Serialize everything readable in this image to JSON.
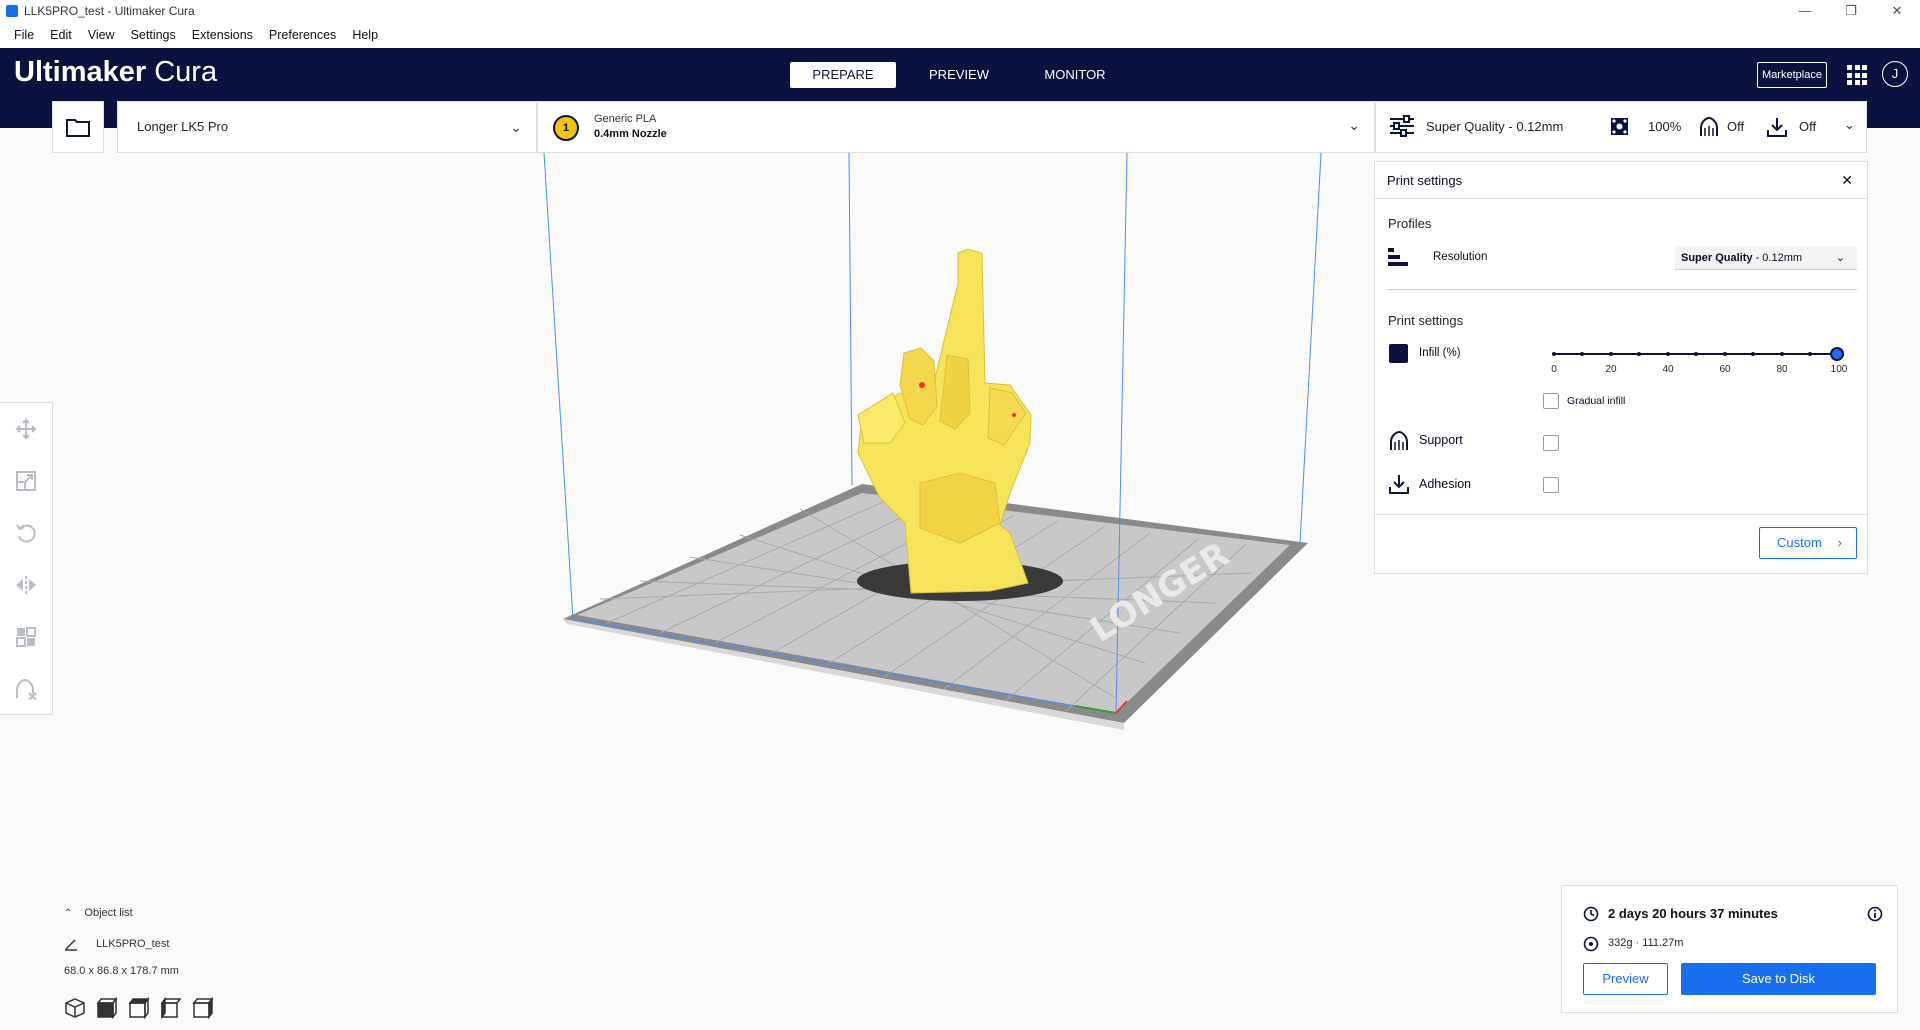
{
  "window": {
    "title": "LLK5PRO_test - Ultimaker Cura",
    "controls": [
      "—",
      "❐",
      "✕"
    ]
  },
  "menu": [
    "File",
    "Edit",
    "View",
    "Settings",
    "Extensions",
    "Preferences",
    "Help"
  ],
  "header": {
    "logo_bold": "Ultimaker",
    "logo_light": "Cura",
    "stages": [
      "PREPARE",
      "PREVIEW",
      "MONITOR"
    ],
    "active_stage": "PREPARE",
    "marketplace_label": "Marketplace",
    "account_initial": "J"
  },
  "machine": {
    "name": "Longer LK5 Pro"
  },
  "material": {
    "extruder_number": "1",
    "name": "Generic PLA",
    "nozzle": "0.4mm Nozzle"
  },
  "summary": {
    "profile": "Super Quality - 0.12mm",
    "infill": "100%",
    "support": "Off",
    "adhesion": "Off"
  },
  "print_settings": {
    "panel_title": "Print settings",
    "profiles_title": "Profiles",
    "resolution_label": "Resolution",
    "resolution_value_bold": "Super Quality",
    "resolution_value_rest": " - 0.12mm",
    "section_title": "Print settings",
    "infill_label": "Infill (%)",
    "infill_ticks": [
      "0",
      "20",
      "40",
      "60",
      "80",
      "100"
    ],
    "infill_value": 100,
    "gradual_infill_label": "Gradual infill",
    "support_label": "Support",
    "adhesion_label": "Adhesion",
    "custom_label": "Custom"
  },
  "object_list": {
    "toggle_label": "Object list",
    "object_name": "LLK5PRO_test",
    "dimensions": "68.0 x 86.8 x 178.7 mm"
  },
  "estimate": {
    "time": "2 days 20 hours 37 minutes",
    "material": "332g · 111.27m",
    "preview_label": "Preview",
    "save_label": "Save to Disk"
  },
  "colors": {
    "header_bg": "#0c1240",
    "accent": "#196ef0",
    "model": "#f7e35a"
  }
}
